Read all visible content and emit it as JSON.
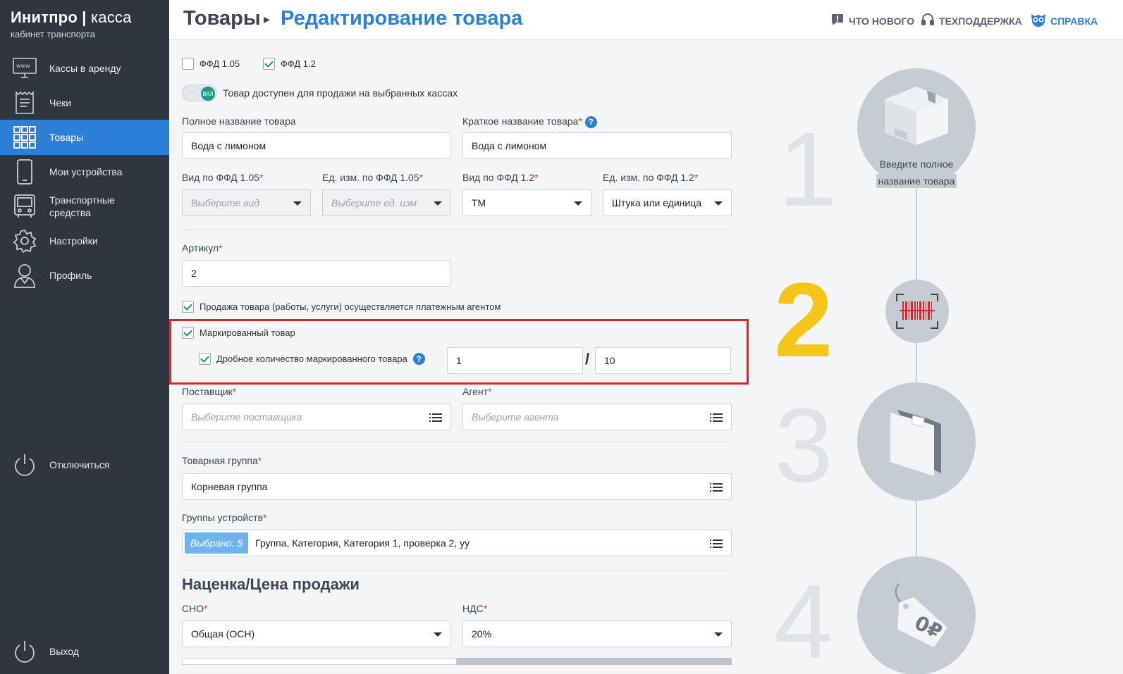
{
  "brand": {
    "title_bold": "Инитпро",
    "title_thin": "касса",
    "subtitle": "кабинет транспорта"
  },
  "sidebar": {
    "items": [
      {
        "label": "Кассы в аренду",
        "icon": "www-monitor-icon"
      },
      {
        "label": "Чеки",
        "icon": "receipt-icon"
      },
      {
        "label": "Товары",
        "icon": "grid-icon",
        "active": true
      },
      {
        "label": "Мои устройства",
        "icon": "phone-icon"
      },
      {
        "label": "Транспортные средства",
        "icon": "bus-icon"
      },
      {
        "label": "Настройки",
        "icon": "gear-icon"
      },
      {
        "label": "Профиль",
        "icon": "user-icon"
      }
    ],
    "disconnect": "Отключиться",
    "logout": "Выход"
  },
  "header": {
    "root": "Товары",
    "current": "Редактирование товара",
    "links": {
      "news": "ЧТО НОВОГО",
      "support": "ТЕХПОДДЕРЖКА",
      "help": "СПРАВКА"
    }
  },
  "form": {
    "ffd105": "ФФД 1.05",
    "ffd12": "ФФД 1.2",
    "toggle_knob": "ВКЛ",
    "toggle_label": "Товар доступен для продажи на выбранных кассах",
    "full_name_label": "Полное название товара",
    "full_name_value": "Вода с лимоном",
    "short_name_label": "Краткое название товара",
    "short_name_value": "Вода с лимоном",
    "kind105_label": "Вид по ФФД 1.05",
    "kind105_placeholder": "Выберите вид",
    "unit105_label": "Ед. изм. по ФФД 1.05",
    "unit105_placeholder": "Выберите ед. изм",
    "kind12_label": "Вид по ФФД 1.2",
    "kind12_value": "ТМ",
    "unit12_label": "Ед. изм. по ФФД 1.2",
    "unit12_value": "Штука или единица",
    "article_label": "Артикул",
    "article_value": "2",
    "agent_sale_label": "Продажа товара (работы, услуги) осуществляется платежным агентом",
    "marked_label": "Маркированный товар",
    "fraction_label": "Дробное количество маркированного товара",
    "fraction_num": "1",
    "fraction_sep": "/",
    "fraction_den": "10",
    "supplier_label": "Поставщик",
    "supplier_placeholder": "Выберите поставщика",
    "agent_label": "Агент",
    "agent_placeholder": "Выберите агента",
    "group_label": "Товарная группа",
    "group_value": "Корневая группа",
    "device_groups_label": "Группы устройств",
    "device_groups_badge": "Выбрано: 5",
    "device_groups_value": "Группа, Категория, Категория 1, проверка 2, уу",
    "markup_title": "Наценка/Цена продажи",
    "sno_label": "СНО",
    "sno_value": "Общая (ОСН)",
    "vat_label": "НДС",
    "vat_value": "20%",
    "required_mark": "*",
    "info_mark": "?"
  },
  "steps": {
    "numbers": [
      "1",
      "2",
      "3",
      "4"
    ],
    "tip_line1": "Введите полное",
    "tip_line2": "название товара"
  },
  "colors": {
    "accent": "#2b7fd7",
    "sidebar": "#2f3640",
    "highlight": "#d7262e",
    "active_step": "#f5c518"
  }
}
